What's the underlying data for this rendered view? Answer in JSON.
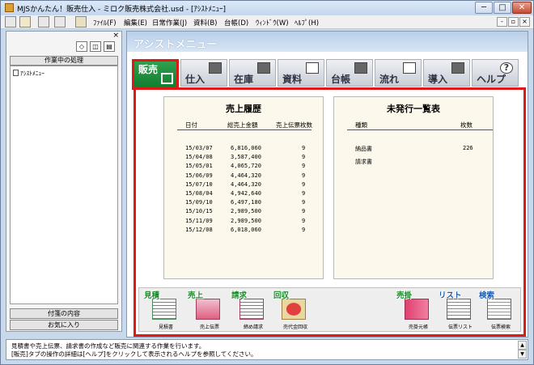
{
  "window": {
    "title": "MJSかんたん！販売仕入 - ミロク販売株式会社.usd - [ｱｼｽﾄﾒﾆｭｰ]",
    "minimize_glyph": "─",
    "maximize_glyph": "□",
    "close_glyph": "✕"
  },
  "menubar": {
    "items": [
      {
        "label": "ﾌｧｲﾙ(F)"
      },
      {
        "label": "編集(E)"
      },
      {
        "label": "日常作業(J)"
      },
      {
        "label": "資料(B)"
      },
      {
        "label": "台帳(D)"
      },
      {
        "label": "ｳｨﾝﾄﾞｳ(W)"
      },
      {
        "label": "ﾍﾙﾌﾟ(H)"
      }
    ],
    "mdi_minimize": "-",
    "mdi_restore": "▫",
    "mdi_close": "×"
  },
  "left_panel": {
    "close_glyph": "×",
    "in_progress_header": "作業中の処理",
    "items": [
      {
        "label": "ｱｼｽﾄﾒﾆｭｰ"
      }
    ],
    "notes_button": "付箋の内容",
    "favorites_button": "お気に入り"
  },
  "main": {
    "header_title": "アシストメニュー",
    "tabs": [
      {
        "label": "販売",
        "active": true
      },
      {
        "label": "仕入"
      },
      {
        "label": "在庫"
      },
      {
        "label": "資料"
      },
      {
        "label": "台帳"
      },
      {
        "label": "流れ"
      },
      {
        "label": "導入"
      },
      {
        "label": "ヘルプ"
      }
    ]
  },
  "sales_history": {
    "title": "売上履歴",
    "columns": [
      "日付",
      "総売上金額",
      "売上伝票枚数"
    ],
    "rows": [
      {
        "date": "15/03/07",
        "amount": "6,816,060",
        "count": "9"
      },
      {
        "date": "15/04/08",
        "amount": "3,587,400",
        "count": "9"
      },
      {
        "date": "15/05/01",
        "amount": "4,065,720",
        "count": "9"
      },
      {
        "date": "15/06/09",
        "amount": "4,464,320",
        "count": "9"
      },
      {
        "date": "15/07/10",
        "amount": "4,464,320",
        "count": "9"
      },
      {
        "date": "15/08/04",
        "amount": "4,942,640",
        "count": "9"
      },
      {
        "date": "15/09/10",
        "amount": "6,497,180",
        "count": "9"
      },
      {
        "date": "15/10/15",
        "amount": "2,989,500",
        "count": "9"
      },
      {
        "date": "15/11/09",
        "amount": "2,989,500",
        "count": "9"
      },
      {
        "date": "15/12/08",
        "amount": "6,018,060",
        "count": "9"
      }
    ]
  },
  "unissued": {
    "title": "未発行一覧表",
    "columns": [
      "種類",
      "枚数"
    ],
    "rows": [
      {
        "type": "納品書",
        "count": "226"
      },
      {
        "type": "請求書",
        "count": ""
      }
    ]
  },
  "shortcuts": [
    {
      "tag": "見積",
      "label": "見積書",
      "tag_color": "green"
    },
    {
      "tag": "売上",
      "label": "売上伝票",
      "tag_color": "green"
    },
    {
      "tag": "請求",
      "label": "締め請求",
      "tag_color": "green"
    },
    {
      "tag": "回収",
      "label": "売代金回収",
      "tag_color": "green"
    },
    {
      "tag": "売掛",
      "label": "売掛元帳",
      "tag_color": "green"
    },
    {
      "tag": "リスト",
      "label": "伝票リスト",
      "tag_color": "blue"
    },
    {
      "tag": "検索",
      "label": "伝票検索",
      "tag_color": "blue"
    }
  ],
  "status": {
    "line1": "見積書や売上伝票、請求書の作成など販売に関連する作業を行います。",
    "line2": "[販売]タブの操作の詳細は[ヘルプ]をクリックして表示されるヘルプを参照してください。"
  },
  "colors": {
    "accent_red": "#e01818",
    "active_tab_green": "#108030",
    "panel_bg": "#fdf8ec"
  }
}
